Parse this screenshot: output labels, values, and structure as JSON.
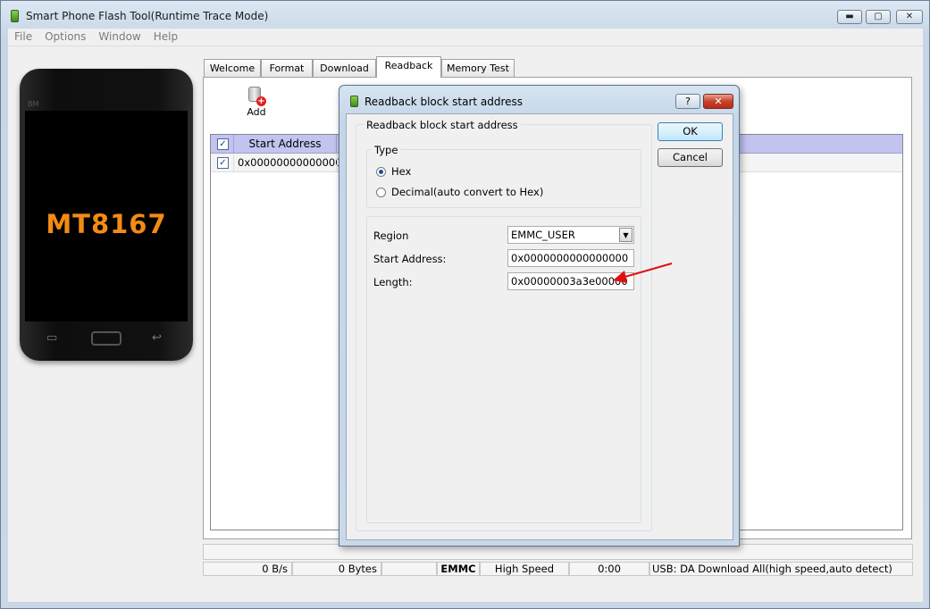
{
  "window": {
    "title": "Smart Phone Flash Tool(Runtime Trace Mode)",
    "min_label": "▬",
    "max_label": "▢",
    "close_label": "✕"
  },
  "menu": [
    "File",
    "Options",
    "Window",
    "Help"
  ],
  "phone": {
    "chip": "MT8167",
    "brand": "BM",
    "menu_key": "▭",
    "back_key": "↩"
  },
  "tabs": [
    "Welcome",
    "Format",
    "Download",
    "Readback",
    "Memory Test"
  ],
  "active_tab": "Readback",
  "toolbar": {
    "add_label": "Add"
  },
  "grid": {
    "headers": {
      "check": "✓",
      "start_address": "Start Address"
    },
    "rows": [
      {
        "checked": "✓",
        "start_address": "0x0000000000000000"
      }
    ]
  },
  "status": {
    "speed": "0 B/s",
    "bytes": "0 Bytes",
    "storage": "EMMC",
    "mode": "High Speed",
    "time": "0:00",
    "usb": "USB: DA Download All(high speed,auto detect)"
  },
  "dialog": {
    "title": "Readback block start address",
    "help_label": "?",
    "close_label": "✕",
    "group_label": "Readback block start address",
    "type_label": "Type",
    "radio_hex": "Hex",
    "radio_decimal": "Decimal(auto convert to Hex)",
    "selected_type": "Hex",
    "region_label": "Region",
    "region_value": "EMMC_USER",
    "start_label": "Start Address:",
    "start_value": "0x0000000000000000",
    "length_label": "Length:",
    "length_value": "0x00000003a3e00000",
    "ok": "OK",
    "cancel": "Cancel"
  },
  "colors": {
    "grid_header": "#c2c3ef",
    "chip_text": "#f28b15",
    "annotation_arrow": "#e01010"
  }
}
